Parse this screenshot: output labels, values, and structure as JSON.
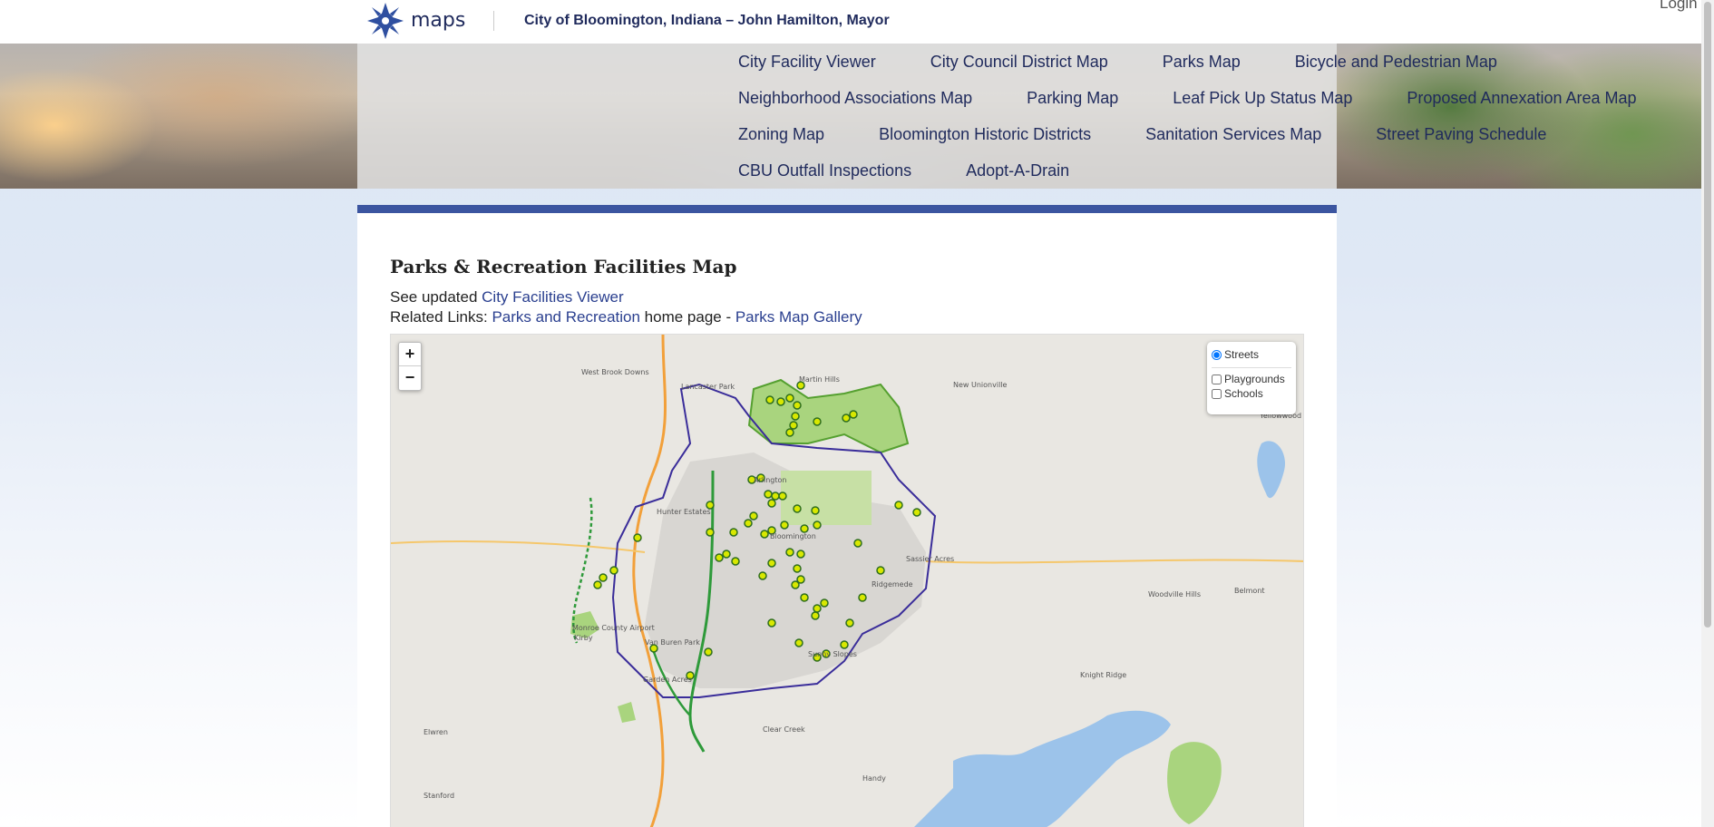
{
  "header": {
    "logo_text": "maps",
    "city_title": "City of Bloomington, Indiana – John Hamilton, Mayor",
    "login_label": "Login"
  },
  "nav": {
    "rows": [
      [
        "City Facility Viewer",
        "City Council District Map",
        "Parks Map",
        "Bicycle and Pedestrian Map"
      ],
      [
        "Neighborhood Associations Map",
        "Parking Map",
        "Leaf Pick Up Status Map",
        "Proposed Annexation Area Map"
      ],
      [
        "Zoning Map",
        "Bloomington Historic Districts",
        "Sanitation Services Map",
        "Street Paving Schedule"
      ],
      [
        "CBU Outfall Inspections",
        "Adopt-A-Drain"
      ]
    ]
  },
  "content": {
    "title": "Parks & Recreation Facilities Map",
    "see_updated_prefix": "See updated ",
    "see_updated_link": "City Facilities Viewer",
    "related_prefix": "Related Links: ",
    "related_link1": "Parks and Recreation",
    "related_middle": " home page - ",
    "related_link2": "Parks Map Gallery"
  },
  "map": {
    "zoom_in": "+",
    "zoom_out": "−",
    "layers": {
      "base": {
        "label": "Streets",
        "checked": true
      },
      "overlays": [
        {
          "label": "Playgrounds",
          "checked": false
        },
        {
          "label": "Schools",
          "checked": false
        }
      ]
    },
    "place_labels": [
      "West Brook Downs",
      "Lancaster Park",
      "Martin Hills",
      "New Unionville",
      "Arlington",
      "Hunter Estates",
      "Bloomington",
      "Ridgemede",
      "Sassier Acres",
      "Woodville Hills",
      "Belmont",
      "Knight Ridge",
      "Kirby",
      "Van Buren Park",
      "Garden Acres",
      "Sunny Slopes",
      "Clear Creek",
      "Handy",
      "Elwren",
      "Stanford",
      "Monroe County Airport",
      "Yellowwood State Forest"
    ],
    "colors": {
      "city_boundary": "#3a2d9a",
      "park_fill": "#a9d47e",
      "park_point": "#d8e800",
      "trail": "#2e9a3a",
      "water": "#9cc3ea",
      "highway": "#f2a03a",
      "urban": "#d8d6d2",
      "campus": "#c7e0a5",
      "land": "#e9e7e2"
    }
  }
}
